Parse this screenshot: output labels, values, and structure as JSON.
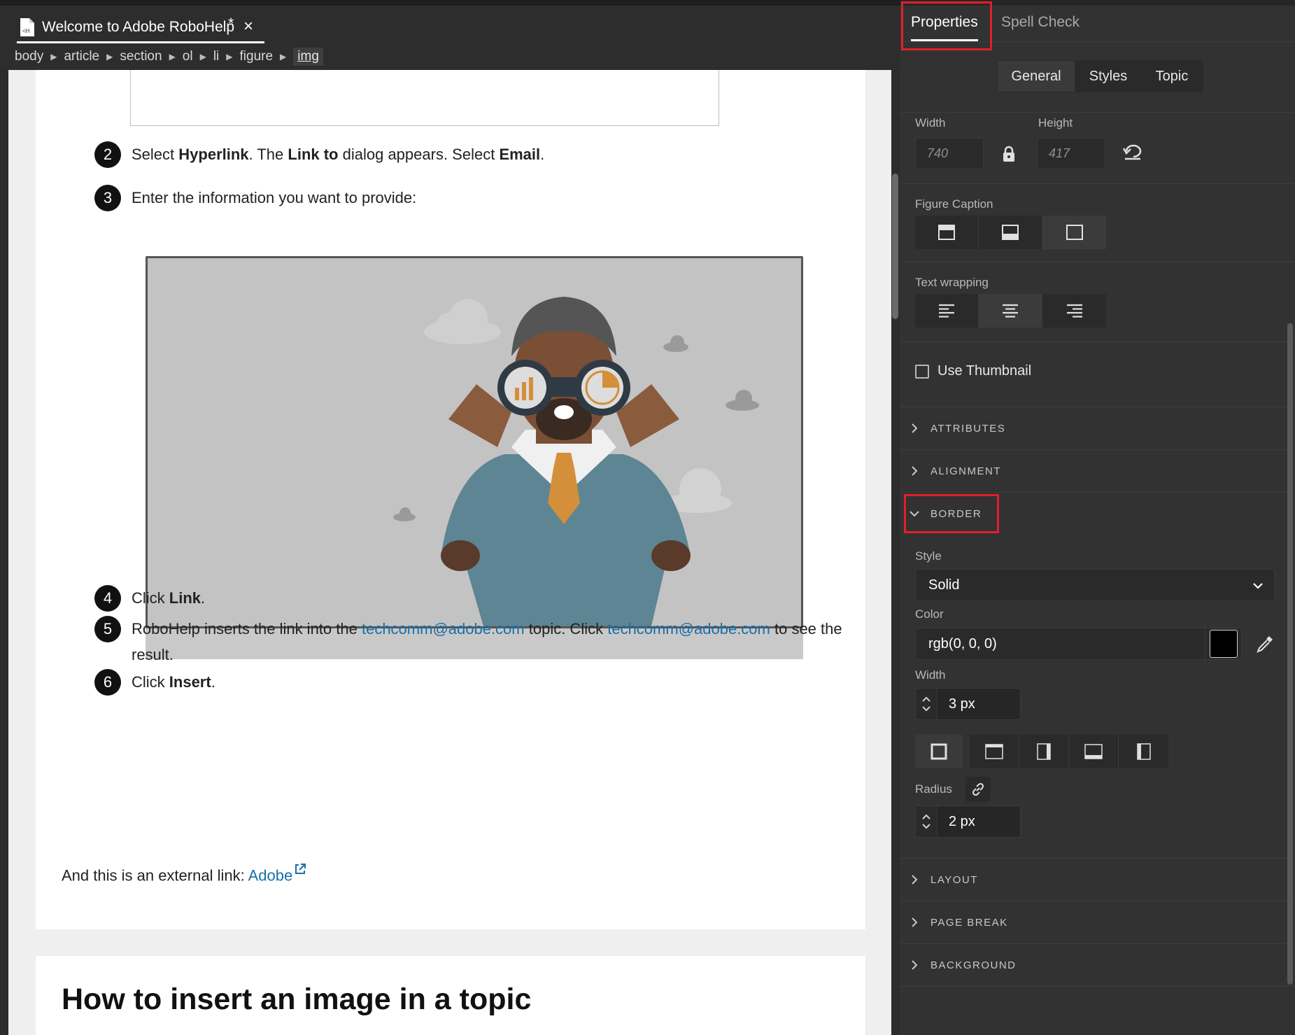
{
  "editor": {
    "tab_title": "Welcome to Adobe RoboHelp",
    "tab_modified": "*",
    "tab_close": "×",
    "breadcrumb": [
      "body",
      "article",
      "section",
      "ol",
      "li",
      "figure"
    ],
    "breadcrumb_current": "img"
  },
  "content": {
    "step2": {
      "num": "2",
      "t1": "Select ",
      "b1": "Hyperlink",
      "t2": ". The ",
      "b2": "Link to",
      "t3": " dialog appears. Select ",
      "b3": "Email",
      "t4": "."
    },
    "step3": {
      "num": "3",
      "text": "Enter the information you want to provide:"
    },
    "step4": {
      "num": "4",
      "t1": "Click ",
      "b1": "Link",
      "t2": "."
    },
    "step5": {
      "num": "5",
      "t1": "RoboHelp inserts the link into the ",
      "link1": "techcomm@adobe.com",
      "t2": " topic. Click ",
      "link2": "techcomm@adobe.com",
      "t3": " to see the",
      "t4": "result."
    },
    "step6": {
      "num": "6",
      "t1": "Click ",
      "b1": "Insert",
      "t2": "."
    },
    "external_text": "And this is an external link: ",
    "external_link": "Adobe",
    "heading2": "How to insert an image in a topic"
  },
  "panel": {
    "tabs": {
      "properties": "Properties",
      "spellcheck": "Spell Check"
    },
    "segments": {
      "general": "General",
      "styles": "Styles",
      "topic": "Topic"
    },
    "width_label": "Width",
    "height_label": "Height",
    "width_value": "740",
    "height_value": "417",
    "figure_caption_label": "Figure Caption",
    "text_wrapping_label": "Text wrapping",
    "use_thumbnail_label": "Use Thumbnail",
    "sections": {
      "attributes": "ATTRIBUTES",
      "alignment": "ALIGNMENT",
      "border": "BORDER",
      "layout": "LAYOUT",
      "page_break": "PAGE BREAK",
      "background": "BACKGROUND"
    },
    "border": {
      "style_label": "Style",
      "style_value": "Solid",
      "color_label": "Color",
      "color_value": "rgb(0, 0, 0)",
      "color_hex": "#000000",
      "width_label": "Width",
      "width_value": "3 px",
      "radius_label": "Radius",
      "radius_value": "2 px"
    }
  },
  "colors": {
    "highlight": "#e0202a",
    "link": "#1a6fa8"
  }
}
